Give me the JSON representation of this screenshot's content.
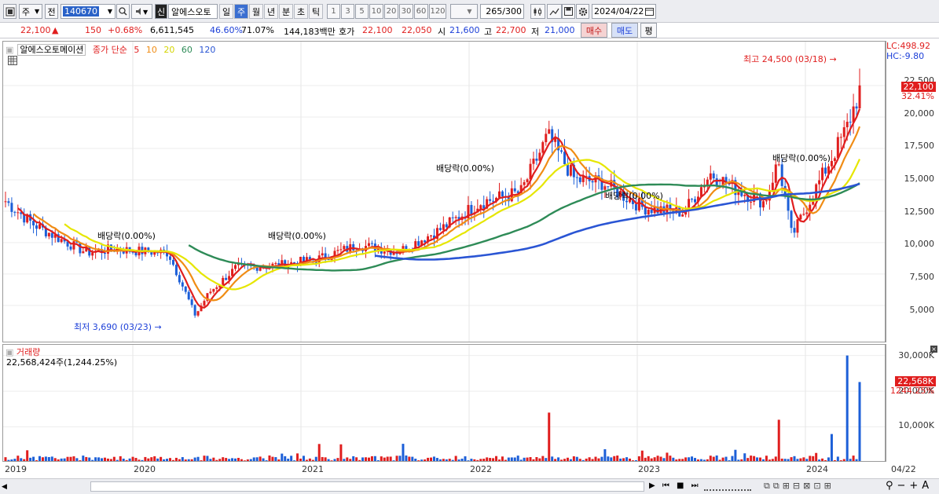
{
  "toolbar": {
    "market": "주",
    "prefix": "전",
    "code": "140670",
    "stock_badge": "신",
    "stock_name": "알에스오토",
    "periods": [
      "일",
      "주",
      "월",
      "년",
      "분",
      "초",
      "틱"
    ],
    "active_period": "주",
    "numbers": [
      "1",
      "3",
      "5",
      "10",
      "20",
      "30",
      "60",
      "120"
    ],
    "count": "265",
    "count_total": "/300",
    "date": "2024/04/22"
  },
  "info": {
    "price": "22,100",
    "arrow": "▲",
    "change": "150",
    "change_pct": "+0.68%",
    "volume": "6,611,545",
    "ratio1": "46.60%",
    "ratio2": "71.07%",
    "amount": "144,183백만",
    "quote_label": "호가",
    "ask": "22,100",
    "bid": "22,050",
    "open_label": "시",
    "open": "21,600",
    "high_label": "고",
    "high": "22,700",
    "low_label": "저",
    "low": "21,000",
    "buy": "매수",
    "sell": "매도",
    "eval": "평"
  },
  "chart": {
    "stock_label": "알에스오토메이션",
    "ma_label": "종가 단순",
    "ma_periods": [
      "5",
      "10",
      "20",
      "60",
      "120"
    ],
    "ma_colors": [
      "#e01e1e",
      "#f08c14",
      "#e6e600",
      "#2e8b57",
      "#2a55d4"
    ],
    "lc": "LC:498.92",
    "hc": "HC:-9.80",
    "y_ticks": [
      "22,500",
      "20,000",
      "17,500",
      "15,000",
      "12,500",
      "10,000",
      "7,500",
      "5,000"
    ],
    "current_tag": "22,100",
    "current_pct": "32.41%",
    "high_note": "최고 24,500 (03/18)",
    "low_note": "최저 3,690 (03/23)",
    "div_label": "배당락(0.00%)"
  },
  "volume": {
    "title": "거래량",
    "value": "22,568,424주(1,244.25%)",
    "y_ticks": [
      "30,000K",
      "20,000K",
      "10,000K"
    ],
    "current_tag": "22,568K",
    "current_pct": "1244.25%"
  },
  "x_labels": [
    "2019",
    "2020",
    "2021",
    "2022",
    "2023",
    "2024",
    "04/22"
  ],
  "chart_data": {
    "type": "candlestick",
    "title": "알에스오토메이션",
    "xlabel": "",
    "ylabel": "",
    "ylim": [
      2500,
      25500
    ],
    "x_range": [
      "2019",
      "2024/04/22"
    ],
    "extremes": {
      "high": 24500,
      "high_date": "03/18",
      "low": 3690,
      "low_date": "03/23"
    },
    "close_path": [
      [
        "2019-01",
        13300
      ],
      [
        "2019-03",
        11500
      ],
      [
        "2019-05",
        10300
      ],
      [
        "2019-07",
        9200
      ],
      [
        "2019-09",
        9500
      ],
      [
        "2019-11",
        9300
      ],
      [
        "2020-01",
        9200
      ],
      [
        "2020-03",
        4200
      ],
      [
        "2020-04",
        6000
      ],
      [
        "2020-06",
        8000
      ],
      [
        "2020-09",
        8200
      ],
      [
        "2020-12",
        8700
      ],
      [
        "2021-03",
        9800
      ],
      [
        "2021-06",
        9300
      ],
      [
        "2021-09",
        11000
      ],
      [
        "2021-12",
        13200
      ],
      [
        "2022-03",
        14000
      ],
      [
        "2022-05",
        18500
      ],
      [
        "2022-07",
        15000
      ],
      [
        "2022-09",
        14800
      ],
      [
        "2022-12",
        12800
      ],
      [
        "2023-03",
        12400
      ],
      [
        "2023-05",
        15500
      ],
      [
        "2023-07",
        14200
      ],
      [
        "2023-09",
        13200
      ],
      [
        "2023-10",
        16500
      ],
      [
        "2023-11",
        10500
      ],
      [
        "2024-01",
        14800
      ],
      [
        "2024-03",
        19000
      ],
      [
        "2024-04",
        22100
      ]
    ],
    "volume_spikes_K": [
      [
        "2022-05",
        14000
      ],
      [
        "2023-10",
        12000
      ],
      [
        "2024-02",
        8000
      ],
      [
        "2024-03",
        30000
      ],
      [
        "2024-04",
        22568
      ]
    ]
  }
}
